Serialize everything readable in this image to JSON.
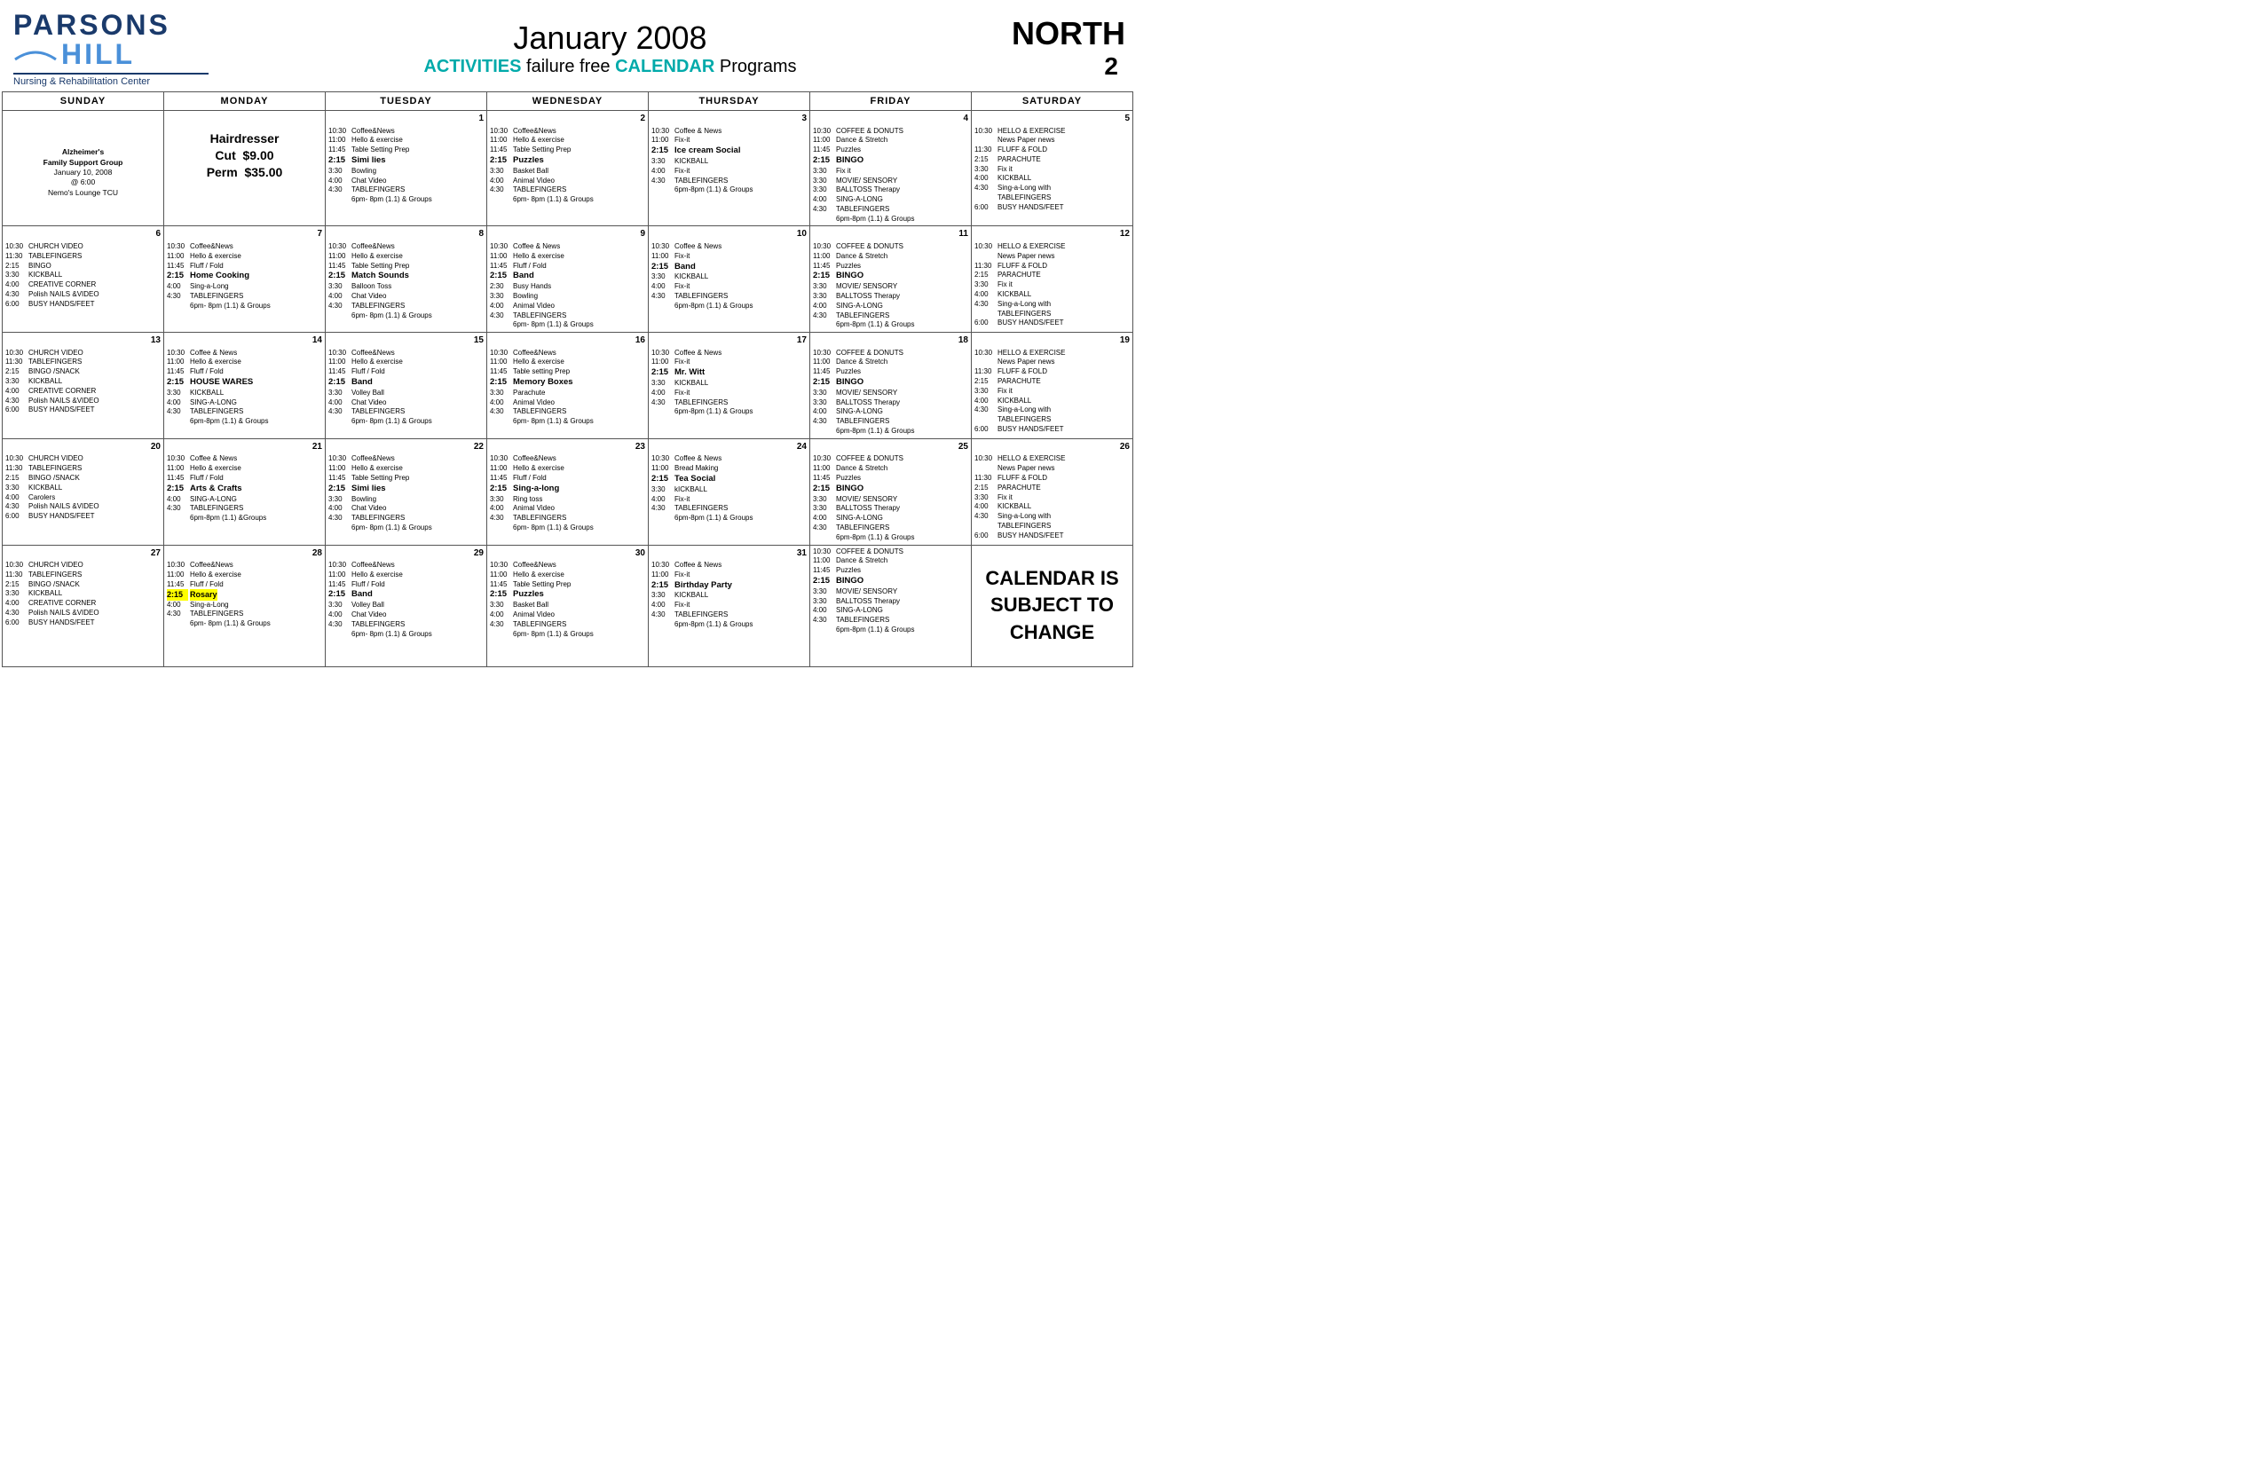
{
  "header": {
    "logo_parsons": "PARSONS",
    "logo_hill": "HILL",
    "logo_nursing": "Nursing & Rehabilitation Center",
    "month_year": "January 2008",
    "activities_label": "ACTIVITIES",
    "failure_free": " failure free ",
    "calendar_label": "CALENDAR",
    "programs": " Programs",
    "north": "NORTH",
    "north_num": "2"
  },
  "days": [
    "SUNDAY",
    "MONDAY",
    "TUESDAY",
    "WEDNESDAY",
    "THURSDAY",
    "FRIDAY",
    "SATURDAY"
  ],
  "notice": "CALENDAR IS SUBJECT TO CHANGE"
}
